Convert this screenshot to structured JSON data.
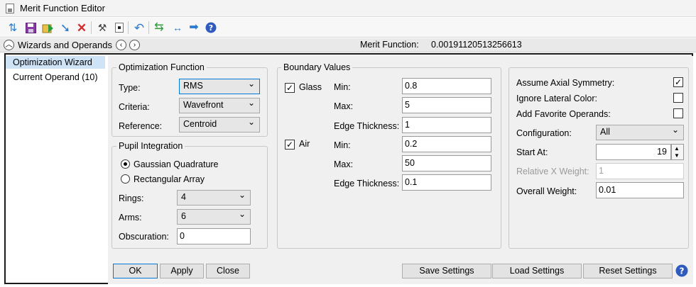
{
  "window": {
    "title": "Merit Function Editor"
  },
  "toolbar": {
    "icons": [
      "refresh-icon",
      "save-icon",
      "load-icon",
      "insert-icon",
      "delete-icon",
      "wizard-icon",
      "stop-icon",
      "undo-icon",
      "update-icon",
      "arrows-icon",
      "next-icon",
      "help-icon"
    ]
  },
  "header": {
    "section_label": "Wizards and Operands",
    "mf_label": "Merit Function:",
    "mf_value": "0.00191120513256613"
  },
  "sidebar": {
    "items": [
      {
        "label": "Optimization Wizard"
      },
      {
        "label": "Current Operand (10)"
      }
    ]
  },
  "optimization_function": {
    "legend": "Optimization Function",
    "type_label": "Type:",
    "type_value": "RMS",
    "criteria_label": "Criteria:",
    "criteria_value": "Wavefront",
    "reference_label": "Reference:",
    "reference_value": "Centroid"
  },
  "pupil_integration": {
    "legend": "Pupil Integration",
    "gaussian_label": "Gaussian Quadrature",
    "rectangular_label": "Rectangular Array",
    "rings_label": "Rings:",
    "rings_value": "4",
    "arms_label": "Arms:",
    "arms_value": "6",
    "obscuration_label": "Obscuration:",
    "obscuration_value": "0"
  },
  "boundary_values": {
    "legend": "Boundary Values",
    "glass_label": "Glass",
    "air_label": "Air",
    "min_label": "Min:",
    "max_label": "Max:",
    "edge_label": "Edge Thickness:",
    "glass_min": "0.8",
    "glass_max": "5",
    "glass_edge": "1",
    "air_min": "0.2",
    "air_max": "50",
    "air_edge": "0.1"
  },
  "options": {
    "axial_label": "Assume Axial Symmetry:",
    "lateral_label": "Ignore Lateral Color:",
    "favorite_label": "Add Favorite Operands:",
    "config_label": "Configuration:",
    "config_value": "All",
    "start_label": "Start At:",
    "start_value": "19",
    "relx_label": "Relative X Weight:",
    "relx_value": "1",
    "overall_label": "Overall Weight:",
    "overall_value": "0.01"
  },
  "buttons": {
    "ok": "OK",
    "apply": "Apply",
    "close": "Close",
    "save": "Save Settings",
    "load": "Load Settings",
    "reset": "Reset Settings"
  },
  "colors": {
    "accent": "#0078d7",
    "selection": "#cfe3f7",
    "panel": "#f0f0f0"
  }
}
